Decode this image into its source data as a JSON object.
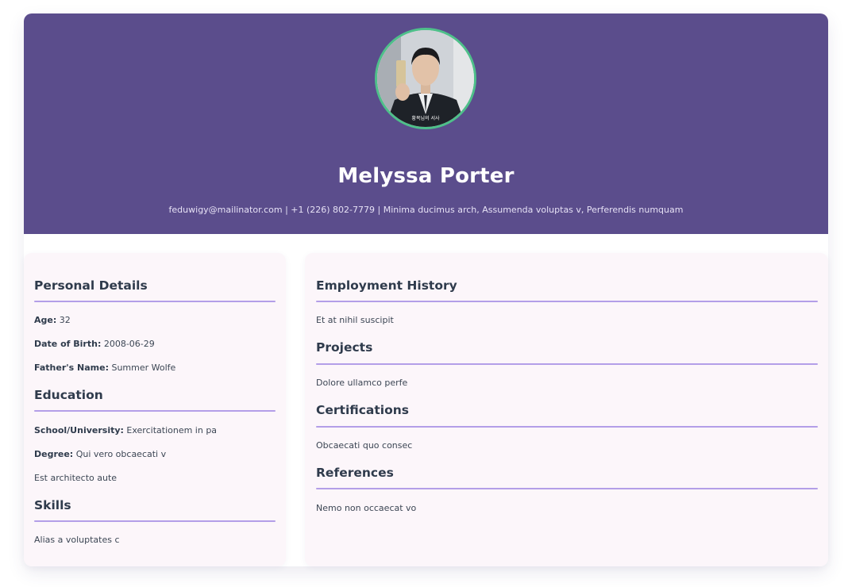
{
  "profile": {
    "name": "Melyssa Porter",
    "contact": "feduwigy@mailinator.com | +1 (226) 802-7779 | Minima ducimus arch, Assumenda voluptas v, Perferendis numquam",
    "photo_caption": "황복님의 서사"
  },
  "personal": {
    "title": "Personal Details",
    "age_label": "Age:",
    "age": "32",
    "dob_label": "Date of Birth:",
    "dob": "2008-06-29",
    "father_label": "Father's Name:",
    "father": "Summer Wolfe"
  },
  "education": {
    "title": "Education",
    "school_label": "School/University:",
    "school": "Exercitationem in pa",
    "degree_label": "Degree:",
    "degree": "Qui vero obcaecati v",
    "note": "Est architecto aute"
  },
  "skills": {
    "title": "Skills",
    "text": "Alias a voluptates c"
  },
  "employment": {
    "title": "Employment History",
    "text": "Et at nihil suscipit"
  },
  "projects": {
    "title": "Projects",
    "text": "Dolore ullamco perfe"
  },
  "certifications": {
    "title": "Certifications",
    "text": "Obcaecati quo consec"
  },
  "references": {
    "title": "References",
    "text": "Nemo non occaecat vo"
  },
  "colors": {
    "header_bg": "#5b4d8c",
    "avatar_ring": "#4ec08a",
    "section_rule": "#b39ee8",
    "panel_bg": "#fcf6fa"
  }
}
